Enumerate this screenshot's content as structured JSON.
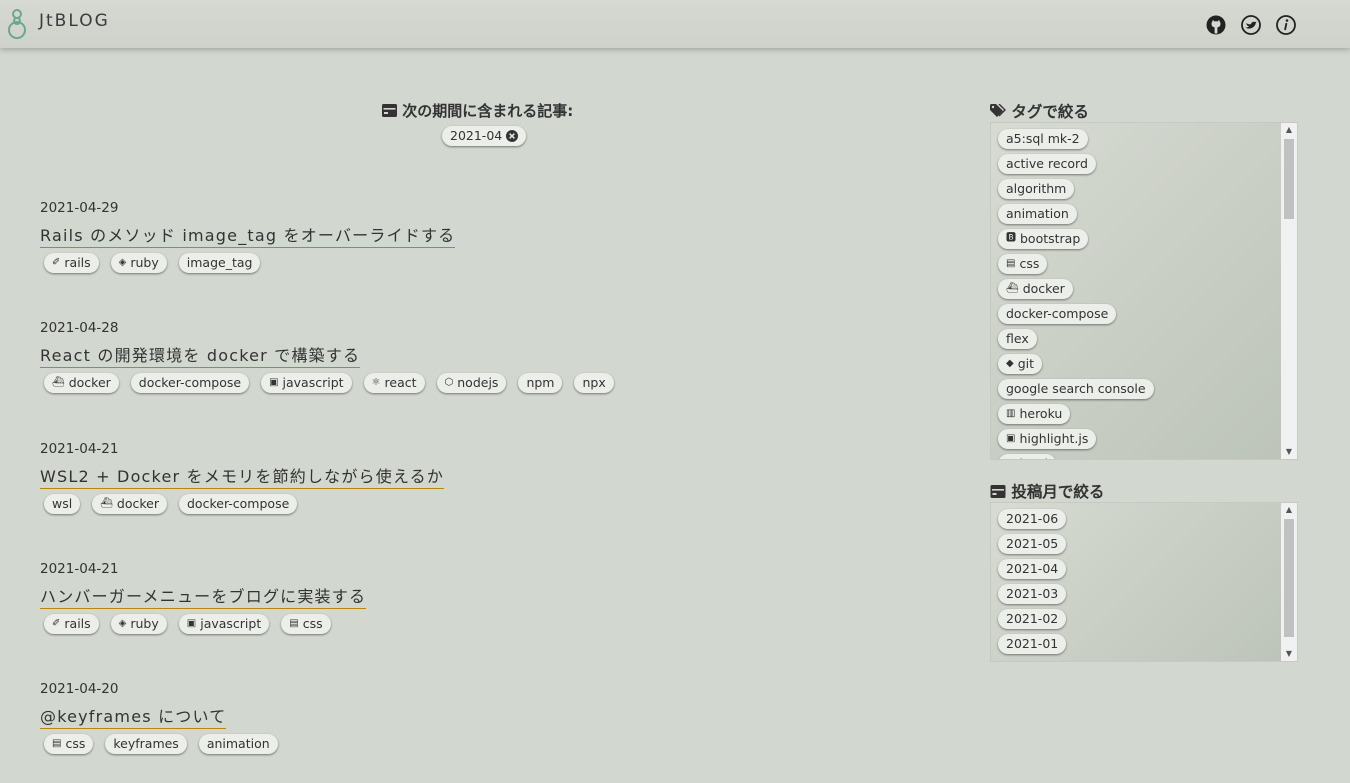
{
  "header": {
    "site_title": "JtBLOG",
    "logo_icon": "ringed-figure-icon",
    "icons": [
      "github-icon",
      "twitter-icon",
      "info-icon"
    ]
  },
  "filter": {
    "heading": "次の期間に含まれる記事:",
    "active_chip": "2021-04",
    "icons": {
      "heading": "calendar-card-icon",
      "remove": "close-circle-icon"
    }
  },
  "articles": [
    {
      "date": "2021-04-29",
      "title": "Rails のメソッド image_tag をオーバーライドする",
      "tags": [
        "rails",
        "ruby",
        "image_tag"
      ]
    },
    {
      "date": "2021-04-28",
      "title": "React の開発環境を docker で構築する",
      "tags": [
        "docker",
        "docker-compose",
        "javascript",
        "react",
        "nodejs",
        "npm",
        "npx"
      ]
    },
    {
      "date": "2021-04-21",
      "title": "WSL2 + Docker をメモリを節約しながら使えるか",
      "tags": [
        "wsl",
        "docker",
        "docker-compose"
      ]
    },
    {
      "date": "2021-04-21",
      "title": "ハンバーガーメニューをブログに実装する",
      "tags": [
        "rails",
        "ruby",
        "javascript",
        "css"
      ]
    },
    {
      "date": "2021-04-20",
      "title": "@keyframes について",
      "tags": [
        "css",
        "keyframes",
        "animation"
      ]
    }
  ],
  "sidebar": {
    "tags_heading": "タグで絞る",
    "tags": [
      "a5:sql mk-2",
      "active record",
      "algorithm",
      "animation",
      "bootstrap",
      "css",
      "docker",
      "docker-compose",
      "flex",
      "git",
      "google search console",
      "heroku",
      "highlight.js",
      "html"
    ],
    "months_heading": "投稿月で絞る",
    "months": [
      "2021-06",
      "2021-05",
      "2021-04",
      "2021-03",
      "2021-02",
      "2021-01"
    ],
    "icons": {
      "tags_heading": "tag-icon",
      "months_heading": "calendar-card-icon"
    }
  },
  "tag_icons": {
    "rails": "rails-icon",
    "ruby": "ruby-icon",
    "docker": "docker-icon",
    "javascript": "javascript-icon",
    "react": "react-icon",
    "nodejs": "nodejs-icon",
    "css": "css-icon",
    "bootstrap": "bootstrap-icon",
    "git": "git-icon",
    "heroku": "heroku-icon",
    "highlight.js": "javascript-icon",
    "html": "html-icon"
  }
}
